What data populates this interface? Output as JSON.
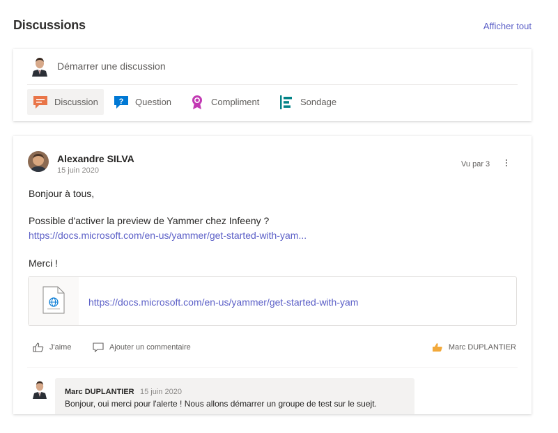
{
  "header": {
    "title": "Discussions",
    "see_all": "Afficher tout"
  },
  "composer": {
    "placeholder": "Démarrer une discussion",
    "types": [
      {
        "label": "Discussion",
        "icon": "discussion-icon",
        "color": "#e97548",
        "active": true
      },
      {
        "label": "Question",
        "icon": "question-icon",
        "color": "#0078d4"
      },
      {
        "label": "Compliment",
        "icon": "compliment-icon",
        "color": "#c239b3"
      },
      {
        "label": "Sondage",
        "icon": "poll-icon",
        "color": "#038387"
      }
    ]
  },
  "post": {
    "author": "Alexandre SILVA",
    "date": "15 juin 2020",
    "seen_by": "Vu par 3",
    "greeting": "Bonjour à tous,",
    "question": "Possible d'activer la preview de Yammer chez Infeeny ?",
    "link_text": "https://docs.microsoft.com/en-us/yammer/get-started-with-yam...",
    "closing": "Merci !",
    "preview_url": "https://docs.microsoft.com/en-us/yammer/get-started-with-yam",
    "like_label": "J'aime",
    "comment_label": "Ajouter un commentaire",
    "liked_by": "Marc DUPLANTIER"
  },
  "reply": {
    "author": "Marc DUPLANTIER",
    "date": "15 juin 2020",
    "text": "Bonjour, oui merci pour l'alerte ! Nous allons démarrer un groupe de test sur le suejt."
  },
  "colors": {
    "accent": "#5b5fc7",
    "like_thumb": "#f2a93b"
  }
}
